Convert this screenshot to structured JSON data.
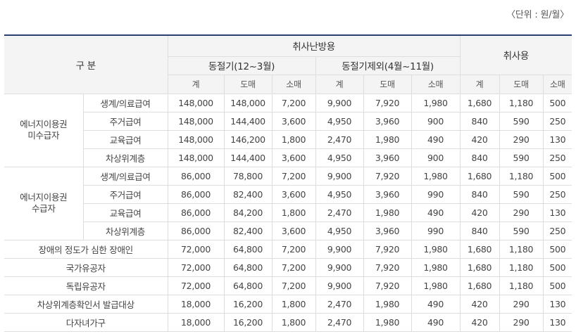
{
  "unit_note": "〈단위 : 원/월〉",
  "header": {
    "category": "구 분",
    "heating": "취사난방용",
    "winter": "동절기(12~3월)",
    "nonwinter": "동절기제외(4월~11월)",
    "cooking": "취사용",
    "col_total": "계",
    "col_wholesale": "도매",
    "col_retail": "소매"
  },
  "rows": [
    {
      "group": "에너지이용권\n미수급자",
      "sub": "생계/의료급여",
      "values": [
        "148,000",
        "148,000",
        "7,200",
        "9,900",
        "7,920",
        "1,980",
        "1,680",
        "1,180",
        "500"
      ]
    },
    {
      "sub": "주거급여",
      "values": [
        "148,000",
        "144,400",
        "3,600",
        "4,950",
        "3,960",
        "900",
        "840",
        "590",
        "250"
      ]
    },
    {
      "sub": "교육급여",
      "values": [
        "148,000",
        "146,200",
        "1,800",
        "2,470",
        "1,980",
        "490",
        "420",
        "290",
        "130"
      ]
    },
    {
      "sub": "차상위계층",
      "values": [
        "148,000",
        "144,400",
        "3,600",
        "4,950",
        "3,960",
        "900",
        "840",
        "590",
        "250"
      ]
    },
    {
      "group": "에너지이용권\n수급자",
      "sub": "생계/의료급여",
      "values": [
        "86,000",
        "78,800",
        "7,200",
        "9,900",
        "7,920",
        "1,980",
        "1,680",
        "1,180",
        "500"
      ]
    },
    {
      "sub": "주거급여",
      "values": [
        "86,000",
        "82,400",
        "3,600",
        "4,950",
        "3,960",
        "990",
        "840",
        "590",
        "250"
      ]
    },
    {
      "sub": "교육급여",
      "values": [
        "86,000",
        "84,200",
        "1,800",
        "2,470",
        "1,980",
        "490",
        "420",
        "290",
        "130"
      ]
    },
    {
      "sub": "차상위계층",
      "values": [
        "86,000",
        "82,400",
        "3,600",
        "4,950",
        "3,960",
        "990",
        "840",
        "590",
        "250"
      ]
    },
    {
      "category": "장애의 정도가 심한 장애인",
      "values": [
        "72,000",
        "64,800",
        "7,200",
        "9,900",
        "7,920",
        "1,980",
        "1,680",
        "1,180",
        "500"
      ]
    },
    {
      "category": "국가유공자",
      "values": [
        "72,000",
        "64,800",
        "7,200",
        "9,900",
        "7,920",
        "1,980",
        "1,680",
        "1,180",
        "500"
      ]
    },
    {
      "category": "독립유공자",
      "values": [
        "72,000",
        "64,800",
        "7,200",
        "9,900",
        "7,920",
        "1,980",
        "1,680",
        "1,180",
        "500"
      ]
    },
    {
      "category": "차상위계층확인서 발급대상",
      "values": [
        "18,000",
        "16,200",
        "1,800",
        "2,470",
        "1,980",
        "490",
        "420",
        "290",
        "130"
      ]
    },
    {
      "category": "다자녀가구",
      "values": [
        "18,000",
        "16,200",
        "1,800",
        "2,470",
        "1,980",
        "490",
        "420",
        "290",
        "130"
      ]
    }
  ]
}
